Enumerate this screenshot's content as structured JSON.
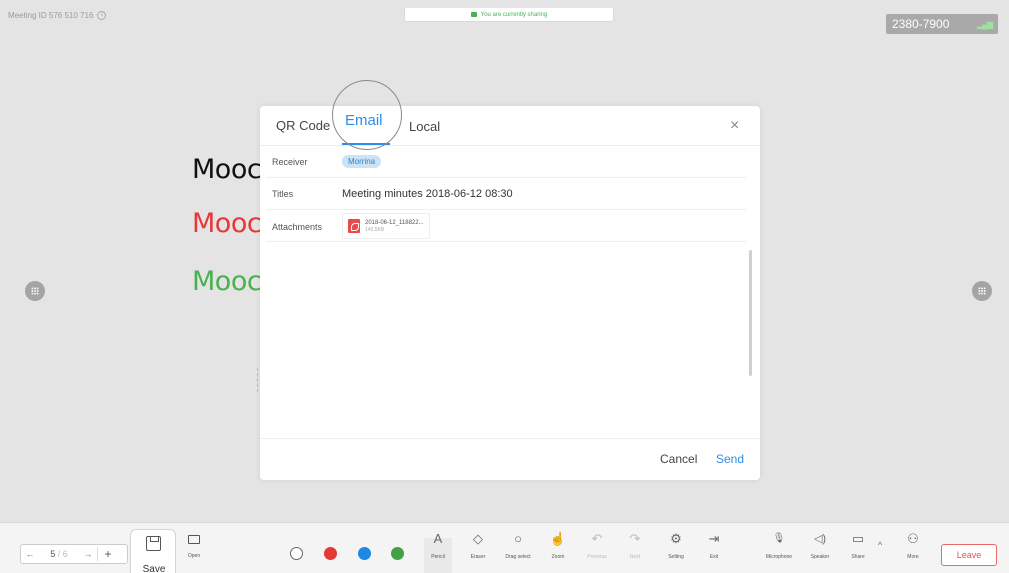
{
  "header": {
    "meeting_id": "Meeting ID 576 510 716",
    "info_icon": "info-icon",
    "share_banner": "You are currently sharing",
    "room_code": "2380-7900",
    "signal": "▂▄▆"
  },
  "whiteboard": {
    "lines": [
      {
        "text": "Mooc",
        "color": "#111111"
      },
      {
        "text": "Mooc",
        "color": "#e53935"
      },
      {
        "text": "Mooc",
        "color": "#4caf50"
      }
    ]
  },
  "dialog": {
    "tabs": [
      "QR Code",
      "Email",
      "Local"
    ],
    "active_tab": "Email",
    "close": "×",
    "receiver_label": "Receiver",
    "receiver_chip": "Morrina",
    "titles_label": "Titles",
    "titles_value": "Meeting  minutes 2018-06-12 08:30",
    "attachments_label": "Attachments",
    "attachment_name": "2018-06-12_118822...",
    "attachment_size": "145.5KB",
    "cancel": "Cancel",
    "send": "Send"
  },
  "toolbar": {
    "pager": {
      "prev": "←",
      "current": "5",
      "total": "/ 6",
      "next": "→",
      "add": "+"
    },
    "save": "Save",
    "open": "Open",
    "colors": [
      "#ffffff",
      "#e53935",
      "#1e88e5",
      "#43a047"
    ],
    "tools": [
      {
        "label": "Pencil",
        "icon": "A"
      },
      {
        "label": "Eraser",
        "icon": "◇"
      },
      {
        "label": "Drag select",
        "icon": "○"
      },
      {
        "label": "Zoom",
        "icon": "☝"
      },
      {
        "label": "Previous",
        "icon": "↶"
      },
      {
        "label": "Next",
        "icon": "↷"
      },
      {
        "label": "Setting",
        "icon": "⚙"
      },
      {
        "label": "Exit",
        "icon": "⇥"
      },
      {
        "label": "Microphone",
        "icon": "🎙"
      },
      {
        "label": "Speaker",
        "icon": "◁)"
      },
      {
        "label": "Share",
        "icon": "▭"
      },
      {
        "label": "More",
        "icon": "⚇"
      }
    ],
    "caret": "^",
    "leave": "Leave"
  }
}
